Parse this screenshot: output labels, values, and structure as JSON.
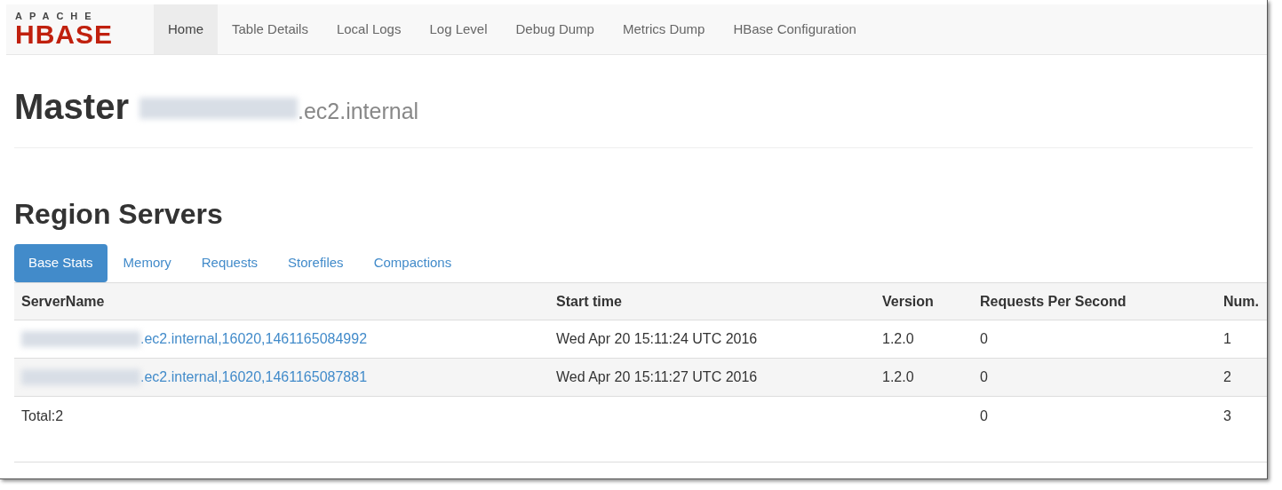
{
  "logo": {
    "top": "APACHE",
    "bottom": "HBASE"
  },
  "nav": [
    {
      "label": "Home",
      "selected": true
    },
    {
      "label": "Table Details",
      "selected": false
    },
    {
      "label": "Local Logs",
      "selected": false
    },
    {
      "label": "Log Level",
      "selected": false
    },
    {
      "label": "Debug Dump",
      "selected": false
    },
    {
      "label": "Metrics Dump",
      "selected": false
    },
    {
      "label": "HBase Configuration",
      "selected": false
    }
  ],
  "master": {
    "title": "Master",
    "host_suffix": ".ec2.internal"
  },
  "region_servers": {
    "title": "Region Servers",
    "tabs": [
      {
        "label": "Base Stats",
        "selected": true
      },
      {
        "label": "Memory",
        "selected": false
      },
      {
        "label": "Requests",
        "selected": false
      },
      {
        "label": "Storefiles",
        "selected": false
      },
      {
        "label": "Compactions",
        "selected": false
      }
    ],
    "table": {
      "columns": [
        "ServerName",
        "Start time",
        "Version",
        "Requests Per Second",
        "Num."
      ],
      "rows": [
        {
          "server_suffix": ".ec2.internal,16020,1461165084992",
          "start_time": "Wed Apr 20 15:11:24 UTC 2016",
          "version": "1.2.0",
          "requests_per_second": "0",
          "column_5": "1"
        },
        {
          "server_suffix": ".ec2.internal,16020,1461165087881",
          "start_time": "Wed Apr 20 15:11:27 UTC 2016",
          "version": "1.2.0",
          "requests_per_second": "0",
          "column_5": "2"
        }
      ],
      "total": {
        "label": "Total:2",
        "requests_per_second": "0",
        "column_5": "3"
      }
    }
  }
}
